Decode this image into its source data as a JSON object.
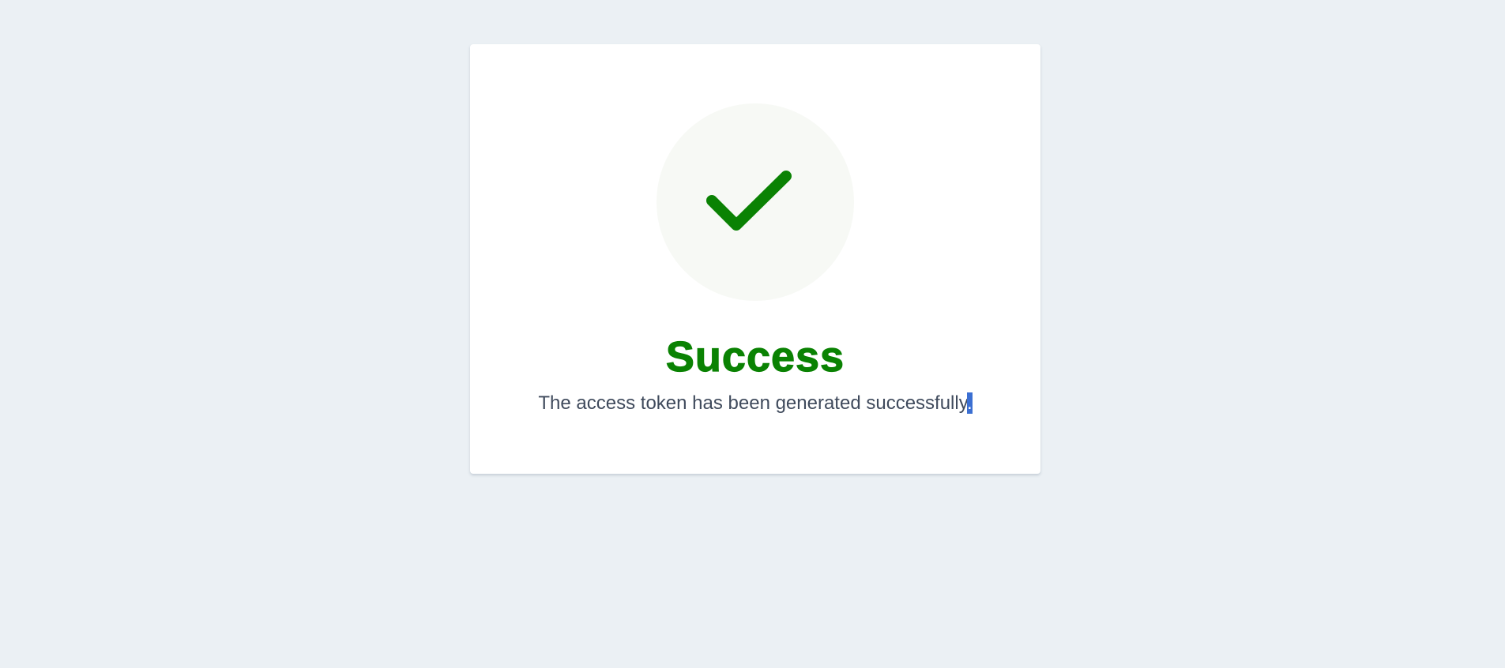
{
  "card": {
    "icon": "checkmark-icon",
    "title": "Success",
    "message_main": "The access token has been generated successfully",
    "message_selected": "."
  },
  "colors": {
    "background": "#ebf0f4",
    "card": "#ffffff",
    "icon_circle": "#f7f9f5",
    "success_green": "#0a8203",
    "text": "#3f4a5c",
    "selection": "#3b6fd2"
  }
}
